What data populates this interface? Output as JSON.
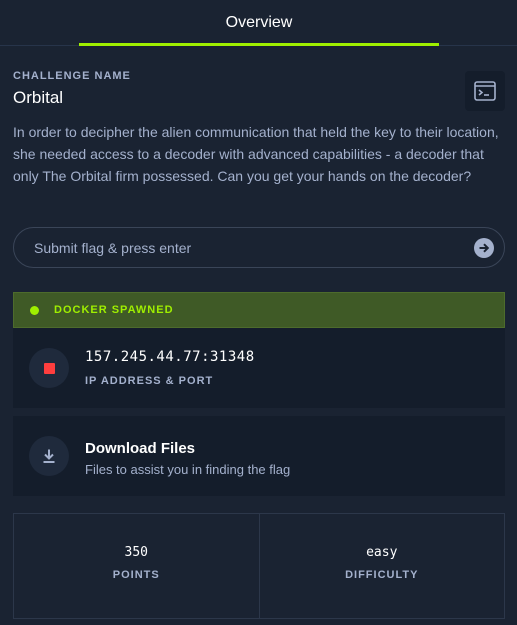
{
  "tabs": [
    {
      "label": "Overview",
      "active": true
    }
  ],
  "challenge": {
    "eyebrow": "CHALLENGE NAME",
    "name": "Orbital",
    "description": "In order to decipher the alien communication that held the key to their location, she needed access to a decoder with advanced capabilities - a decoder that only The Orbital firm possessed. Can you get your hands on the decoder?"
  },
  "flag": {
    "value": "",
    "placeholder": "Submit flag & press enter"
  },
  "docker": {
    "status": "DOCKER SPAWNED",
    "ip_port": "157.245.44.77:31348",
    "ip_label": "IP ADDRESS & PORT"
  },
  "download": {
    "title": "Download Files",
    "subtitle": "Files to assist you in finding the flag"
  },
  "stats": {
    "points_value": "350",
    "points_label": "POINTS",
    "difficulty_value": "easy",
    "difficulty_label": "DIFFICULTY"
  },
  "colors": {
    "accent": "#9fef00",
    "stop": "#ff3e3e",
    "background": "#1a2332",
    "card": "#141d2b",
    "muted_text": "#a4b1cd"
  },
  "icons": [
    "console-icon",
    "arrow-right-circle-icon",
    "status-dot-icon",
    "stop-icon",
    "download-icon"
  ]
}
